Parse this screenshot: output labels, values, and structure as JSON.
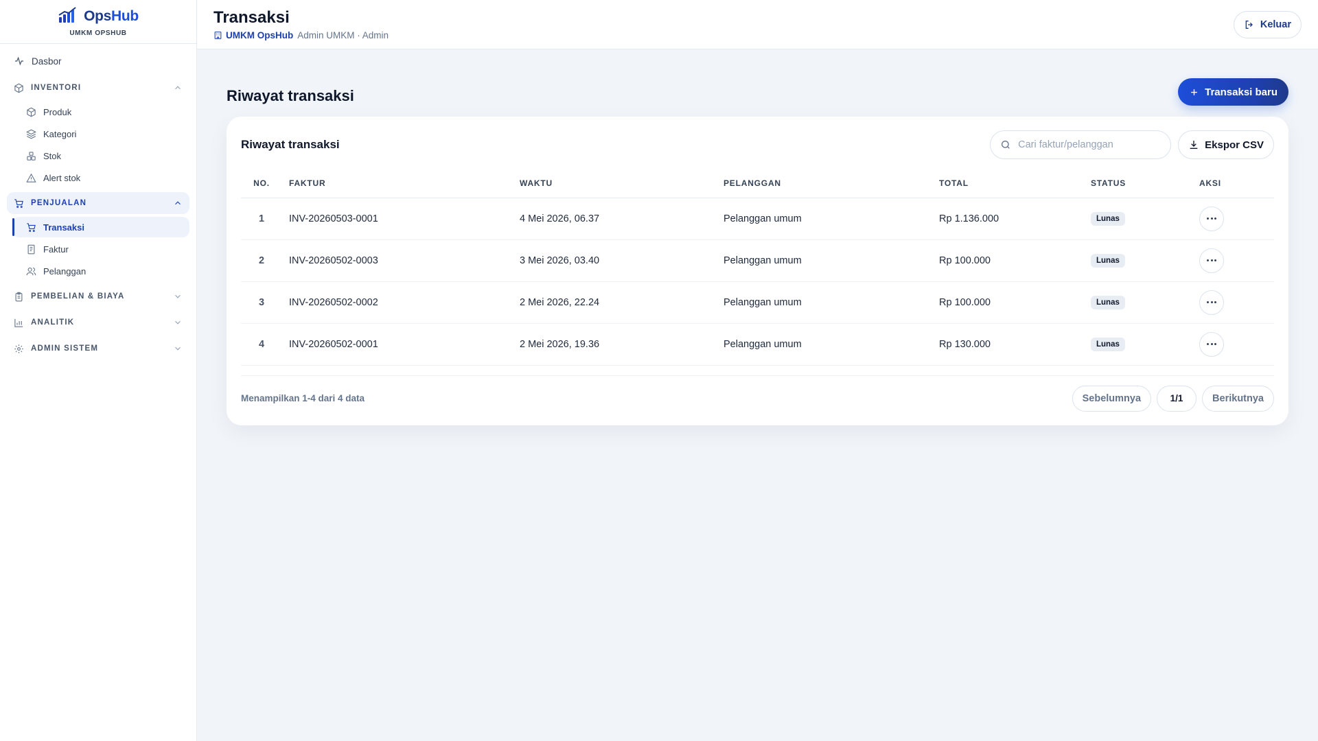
{
  "brand": {
    "name_part1": "Ops",
    "name_part2": "Hub",
    "subtitle": "UMKM OPSHUB"
  },
  "sidebar": {
    "dashboard": "Dasbor",
    "groups": [
      {
        "label": "INVENTORI",
        "items": [
          "Produk",
          "Kategori",
          "Stok",
          "Alert stok"
        ]
      },
      {
        "label": "PENJUALAN",
        "items": [
          "Transaksi",
          "Faktur",
          "Pelanggan"
        ]
      },
      {
        "label": "PEMBELIAN & BIAYA"
      },
      {
        "label": "ANALITIK"
      },
      {
        "label": "ADMIN SISTEM"
      }
    ]
  },
  "header": {
    "title": "Transaksi",
    "org": "UMKM OpsHub",
    "user": "Admin UMKM · Admin",
    "logout": "Keluar"
  },
  "section": {
    "title": "Riwayat transaksi",
    "new_button": "Transaksi baru"
  },
  "card": {
    "title": "Riwayat transaksi",
    "search_placeholder": "Cari faktur/pelanggan",
    "export": "Ekspor CSV"
  },
  "table": {
    "columns": [
      "NO.",
      "FAKTUR",
      "WAKTU",
      "PELANGGAN",
      "TOTAL",
      "STATUS",
      "AKSI"
    ],
    "rows": [
      {
        "no": "1",
        "faktur": "INV-20260503-0001",
        "waktu": "4 Mei 2026, 06.37",
        "pelanggan": "Pelanggan umum",
        "total": "Rp 1.136.000",
        "status": "Lunas"
      },
      {
        "no": "2",
        "faktur": "INV-20260502-0003",
        "waktu": "3 Mei 2026, 03.40",
        "pelanggan": "Pelanggan umum",
        "total": "Rp 100.000",
        "status": "Lunas"
      },
      {
        "no": "3",
        "faktur": "INV-20260502-0002",
        "waktu": "2 Mei 2026, 22.24",
        "pelanggan": "Pelanggan umum",
        "total": "Rp 100.000",
        "status": "Lunas"
      },
      {
        "no": "4",
        "faktur": "INV-20260502-0001",
        "waktu": "2 Mei 2026, 19.36",
        "pelanggan": "Pelanggan umum",
        "total": "Rp 130.000",
        "status": "Lunas"
      }
    ]
  },
  "footer": {
    "info": "Menampilkan 1-4 dari 4 data",
    "prev": "Sebelumnya",
    "page": "1/1",
    "next": "Berikutnya"
  },
  "colors": {
    "accent": "#1e40af",
    "brand": "#1d4ed8",
    "background": "#f1f5fa"
  }
}
